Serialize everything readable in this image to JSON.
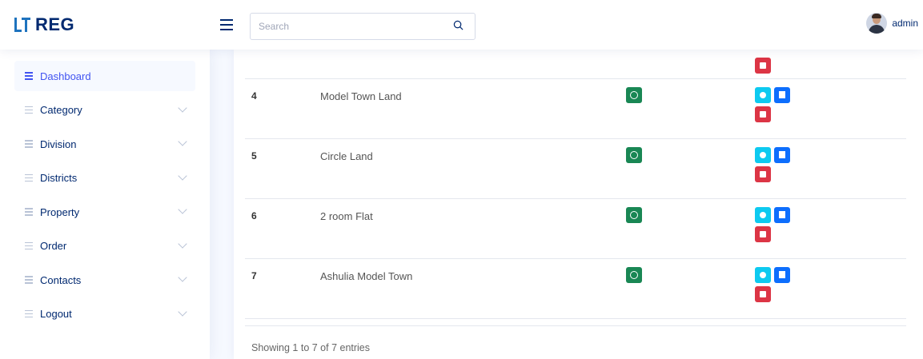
{
  "brand": {
    "name": "REG"
  },
  "header": {
    "search": {
      "placeholder": "Search",
      "value": ""
    },
    "user": {
      "name": "admin"
    }
  },
  "sidebar": {
    "items": [
      {
        "label": "Dashboard",
        "active": true,
        "expandable": false
      },
      {
        "label": "Category",
        "active": false,
        "expandable": true
      },
      {
        "label": "Division",
        "active": false,
        "expandable": true
      },
      {
        "label": "Districts",
        "active": false,
        "expandable": true
      },
      {
        "label": "Property",
        "active": false,
        "expandable": true
      },
      {
        "label": "Order",
        "active": false,
        "expandable": true
      },
      {
        "label": "Contacts",
        "active": false,
        "expandable": true
      },
      {
        "label": "Logout",
        "active": false,
        "expandable": true
      }
    ]
  },
  "table": {
    "rows": [
      {
        "no": "4",
        "name": "Model Town Land"
      },
      {
        "no": "5",
        "name": "Circle Land"
      },
      {
        "no": "6",
        "name": "2 room Flat"
      },
      {
        "no": "7",
        "name": "Ashulia Model Town"
      }
    ],
    "footer": "Showing 1 to 7 of 7 entries"
  },
  "colors": {
    "accent": "#4154f1",
    "brand": "#012970",
    "status": "#198754",
    "view": "#0dcaf0",
    "edit": "#0d6efd",
    "delete": "#dc3545"
  }
}
